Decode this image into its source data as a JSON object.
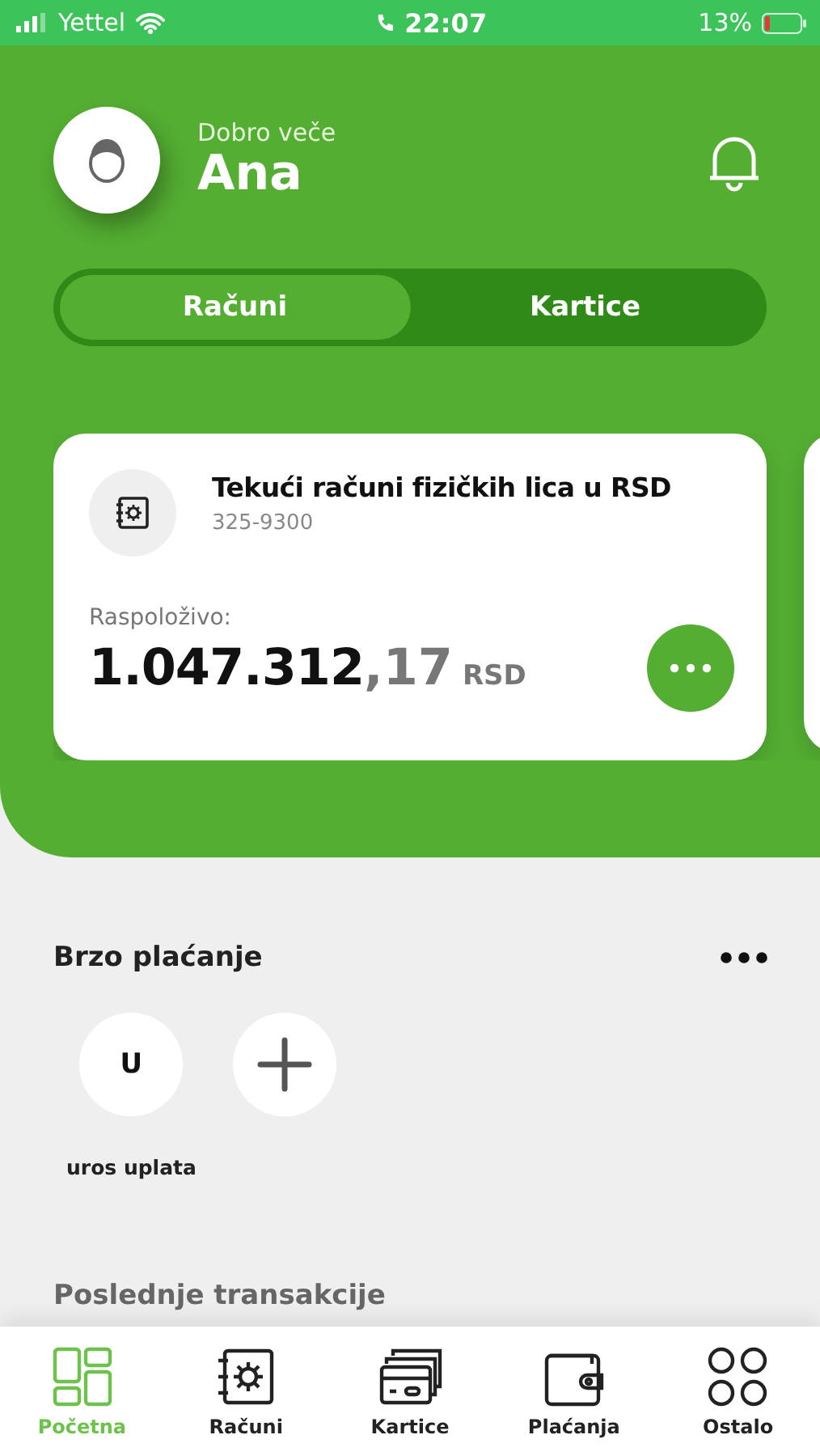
{
  "status_bar": {
    "carrier": "Yettel",
    "time": "22:07",
    "battery": "13%"
  },
  "header": {
    "greeting": "Dobro veče",
    "name": "Ana"
  },
  "tabs": [
    {
      "label": "Računi",
      "selected": true
    },
    {
      "label": "Kartice",
      "selected": false
    }
  ],
  "account": {
    "title": "Tekući računi fizičkih lica u RSD",
    "number": "325-9300",
    "balance_label": "Raspoloživo:",
    "amount_main": "1.047.312",
    "amount_decimals": ",17",
    "currency": "RSD"
  },
  "quick_pay": {
    "title": "Brzo plaćanje",
    "contacts": [
      {
        "kind": "contact",
        "initial": "U",
        "label": "uros uplata"
      },
      {
        "kind": "add"
      }
    ]
  },
  "recent": {
    "title": "Poslednje transakcije"
  },
  "nav": [
    {
      "kind": "home",
      "label": "Početna",
      "selected": true
    },
    {
      "kind": "accounts",
      "label": "Računi",
      "selected": false
    },
    {
      "kind": "cards",
      "label": "Kartice",
      "selected": false
    },
    {
      "kind": "payments",
      "label": "Plaćanja",
      "selected": false
    },
    {
      "kind": "more",
      "label": "Ostalo",
      "selected": false
    }
  ]
}
